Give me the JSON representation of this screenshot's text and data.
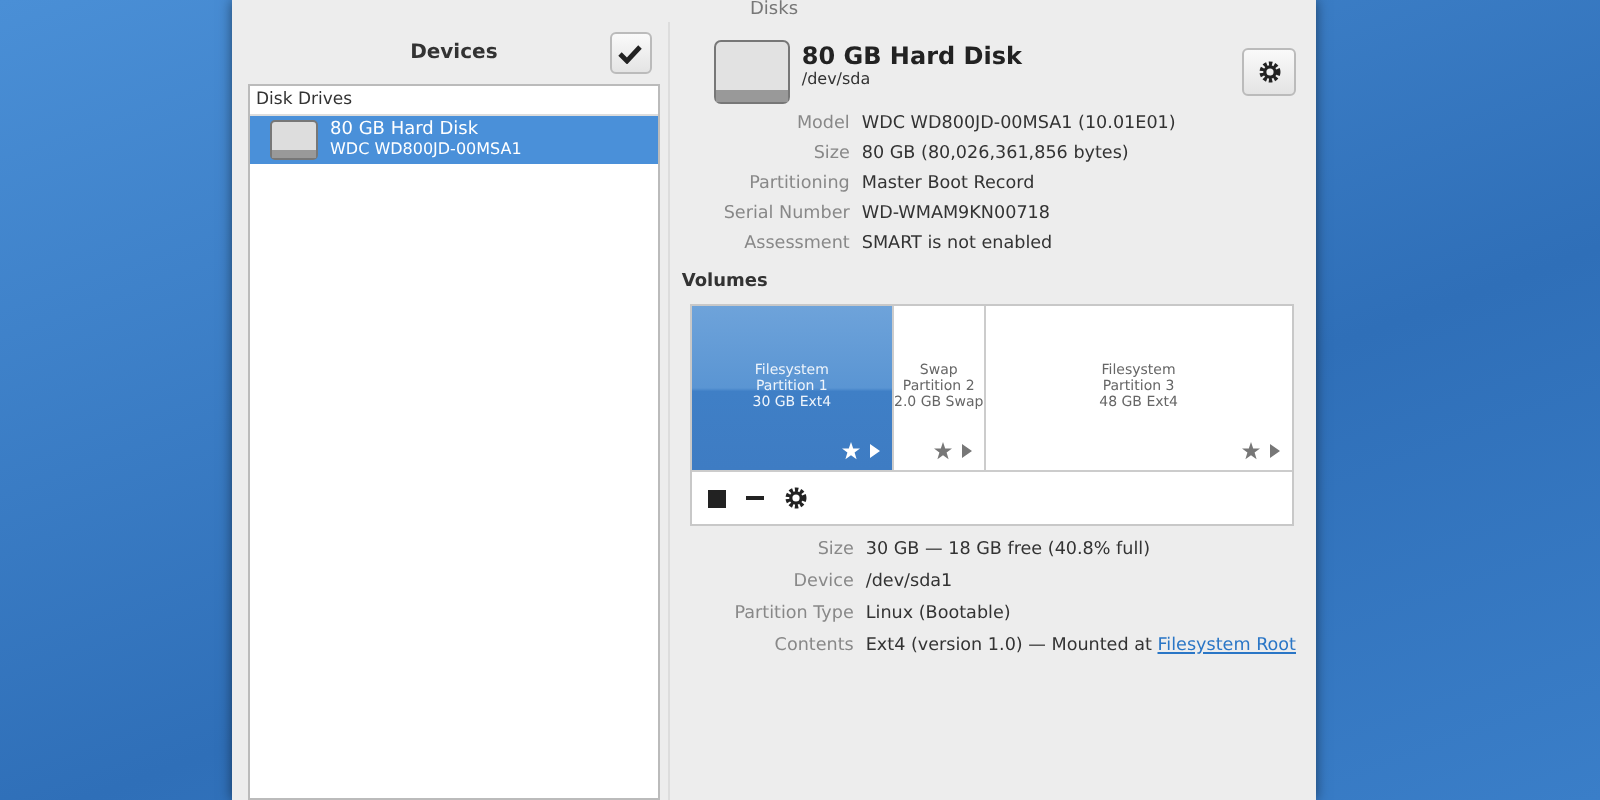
{
  "window": {
    "title": "Disks"
  },
  "sidebar": {
    "title": "Devices",
    "section": "Disk Drives",
    "items": [
      {
        "name": "80 GB Hard Disk",
        "model": "WDC WD800JD-00MSA1",
        "selected": true
      }
    ]
  },
  "disk": {
    "name": "80 GB Hard Disk",
    "device": "/dev/sda",
    "properties": [
      {
        "label": "Model",
        "value": "WDC WD800JD-00MSA1 (10.01E01)"
      },
      {
        "label": "Size",
        "value": "80 GB (80,026,361,856 bytes)"
      },
      {
        "label": "Partitioning",
        "value": "Master Boot Record"
      },
      {
        "label": "Serial Number",
        "value": "WD-WMAM9KN00718"
      },
      {
        "label": "Assessment",
        "value": "SMART is not enabled"
      }
    ]
  },
  "volumes": {
    "title": "Volumes",
    "partitions": [
      {
        "type": "Filesystem",
        "name": "Partition 1",
        "size": "30 GB Ext4",
        "selected": true
      },
      {
        "type": "Swap",
        "name": "Partition 2",
        "size": "2.0 GB Swap",
        "selected": false
      },
      {
        "type": "Filesystem",
        "name": "Partition 3",
        "size": "48 GB Ext4",
        "selected": false
      }
    ],
    "properties": [
      {
        "label": "Size",
        "value": "30 GB — 18 GB free (40.8% full)"
      },
      {
        "label": "Device",
        "value": "/dev/sda1"
      },
      {
        "label": "Partition Type",
        "value": "Linux (Bootable)"
      },
      {
        "label": "Contents",
        "value": "Ext4 (version 1.0) — Mounted at ",
        "link": "Filesystem Root"
      }
    ]
  }
}
